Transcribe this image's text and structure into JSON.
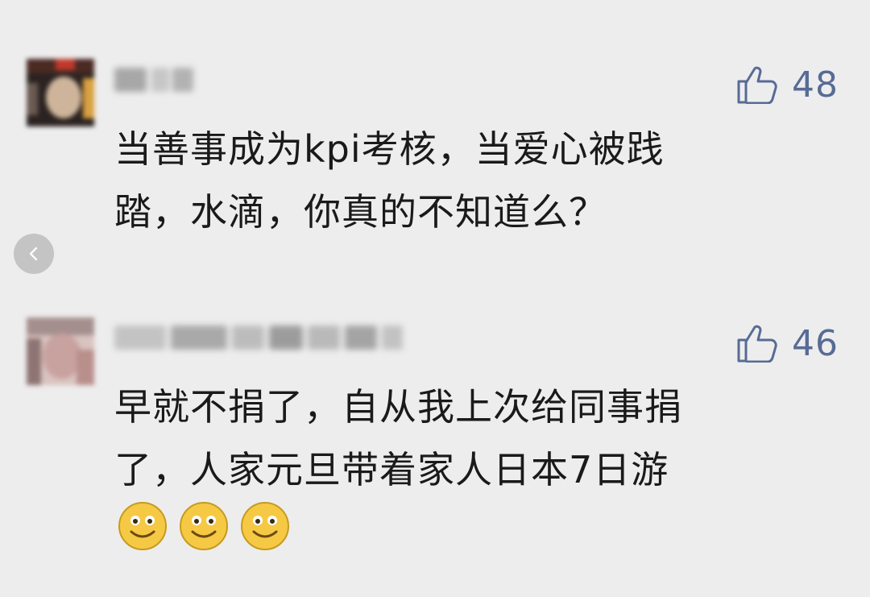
{
  "comments": [
    {
      "likes": "48",
      "text": "当善事成为kpi考核，当爱心被践\n踏，水滴，你真的不知道么？",
      "avatar_icon": "blurred-avatar-icon"
    },
    {
      "likes": "46",
      "text": "早就不捐了，自从我上次给同事捐\n了，人家元旦带着家人日本7日游",
      "emoji_icons": [
        "smiley-face-icon",
        "smiley-face-icon",
        "smiley-face-icon"
      ],
      "avatar_icon": "blurred-avatar-icon"
    }
  ],
  "colors": {
    "background": "#ededed",
    "like_blue": "#576b95",
    "text": "#1a1a1a"
  },
  "icons": {
    "like": "thumbs-up-icon",
    "back": "chevron-left-icon"
  }
}
